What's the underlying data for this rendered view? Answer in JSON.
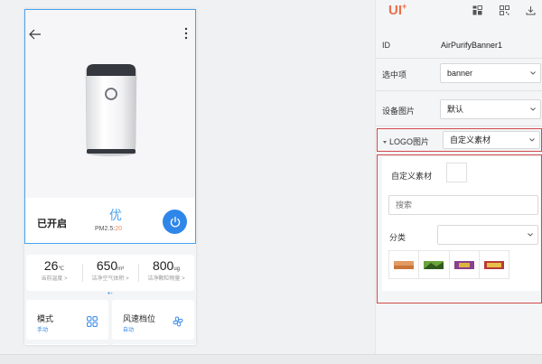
{
  "phone": {
    "status_text": "已开启",
    "air_quality": "优",
    "pm_label": "PM2.5:",
    "pm_value": "20",
    "stats": [
      {
        "value": "26",
        "unit": "℃",
        "label": "当前温度 >"
      },
      {
        "value": "650",
        "unit": "m³",
        "label": "洁净空气体积 >"
      },
      {
        "value": "800",
        "unit": "ug",
        "label": "洁净颗粒物量 >"
      }
    ],
    "mode_card": {
      "title": "模式",
      "sub": "手动"
    },
    "fan_card": {
      "title": "风速档位",
      "sub": "自动"
    }
  },
  "panel": {
    "logo": "UI",
    "id_label": "ID",
    "id_value": "AirPurifyBanner1",
    "selected_label": "选中项",
    "selected_value": "banner",
    "device_image_label": "设备图片",
    "device_image_value": "默认",
    "logo_image_label": "LOGO图片",
    "logo_image_value": "自定义素材",
    "custom_label": "自定义素材",
    "search_placeholder": "搜索",
    "category_label": "分类",
    "category_value": ""
  },
  "colors": {
    "accent": "#2f86e9",
    "selection": "#4aa3f0",
    "highlight_border": "#d04a4a",
    "logo": "#e8704b"
  }
}
